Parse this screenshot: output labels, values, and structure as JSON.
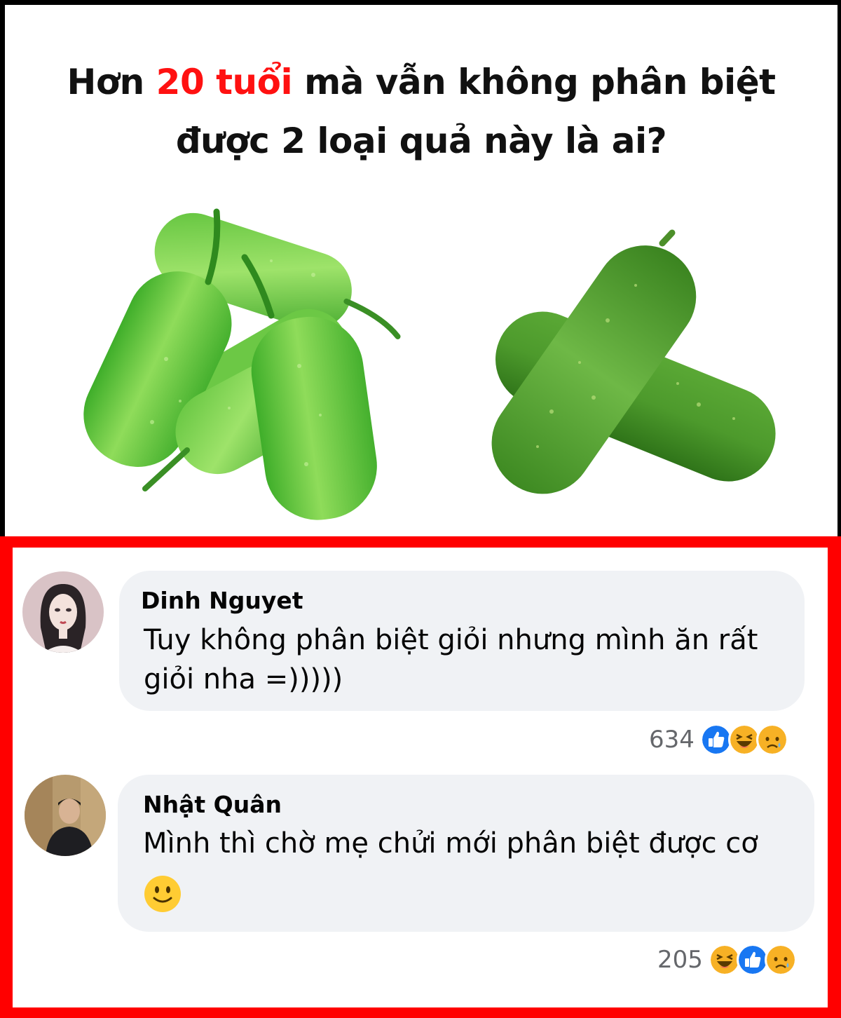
{
  "post": {
    "headline_prefix": "Hơn ",
    "headline_accent": "20 tuổi",
    "headline_rest_line1": " mà vẫn không phân biệt",
    "headline_line2": "được 2 loại quả này là ai?",
    "accent_color": "#ff1111"
  },
  "comments": [
    {
      "author": "Dinh Nguyet",
      "text_line1": "Tuy không phân biệt giỏi nhưng mình ăn rất",
      "text_line2": "giỏi nha =)))))",
      "reaction_count": "634",
      "reactions": [
        "like-icon",
        "haha-icon",
        "sad-icon"
      ]
    },
    {
      "author": "Nhật Quân",
      "text_line1": "Mình thì chờ mẹ chửi mới phân biệt được cơ",
      "emoji": "🙂",
      "reaction_count": "205",
      "reactions": [
        "haha-icon",
        "like-icon",
        "sad-icon"
      ]
    }
  ],
  "colors": {
    "highlight_border": "#ff0000",
    "bubble": "#f0f2f5",
    "like_blue": "#1877f2",
    "reaction_yellow": "#f7b125"
  }
}
